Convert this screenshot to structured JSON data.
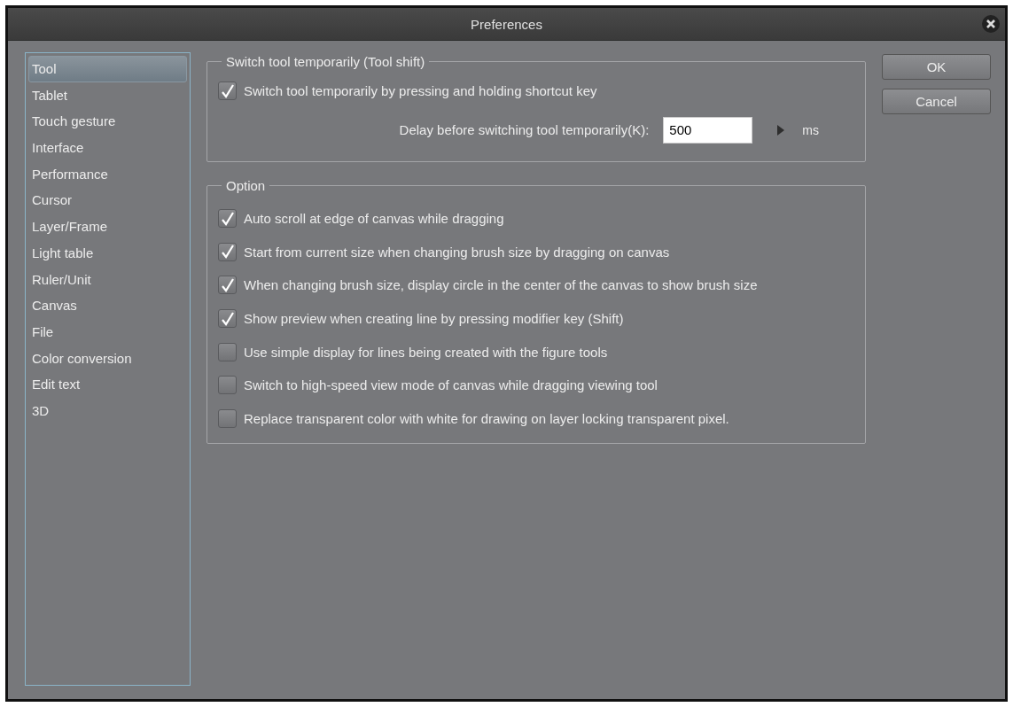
{
  "window": {
    "title": "Preferences"
  },
  "sidebar": {
    "items": [
      {
        "label": "Tool",
        "selected": true
      },
      {
        "label": "Tablet",
        "selected": false
      },
      {
        "label": "Touch gesture",
        "selected": false
      },
      {
        "label": "Interface",
        "selected": false
      },
      {
        "label": "Performance",
        "selected": false
      },
      {
        "label": "Cursor",
        "selected": false
      },
      {
        "label": "Layer/Frame",
        "selected": false
      },
      {
        "label": "Light table",
        "selected": false
      },
      {
        "label": "Ruler/Unit",
        "selected": false
      },
      {
        "label": "Canvas",
        "selected": false
      },
      {
        "label": "File",
        "selected": false
      },
      {
        "label": "Color conversion",
        "selected": false
      },
      {
        "label": "Edit text",
        "selected": false
      },
      {
        "label": "3D",
        "selected": false
      }
    ]
  },
  "tool_shift": {
    "title": "Switch tool temporarily (Tool shift)",
    "checkbox": {
      "label": "Switch tool temporarily by pressing and holding shortcut key",
      "checked": true
    },
    "delay": {
      "label": "Delay before switching tool temporarily(K):",
      "value": "500",
      "unit": "ms"
    }
  },
  "option": {
    "title": "Option",
    "items": [
      {
        "label": "Auto scroll at edge of canvas while dragging",
        "checked": true
      },
      {
        "label": "Start from current size when changing brush size by dragging on canvas",
        "checked": true
      },
      {
        "label": "When changing brush size, display circle in the center of the canvas to show brush size",
        "checked": true
      },
      {
        "label": "Show preview when creating line by pressing modifier key (Shift)",
        "checked": true
      },
      {
        "label": "Use simple display for lines being created with the figure tools",
        "checked": false
      },
      {
        "label": "Switch to high-speed view mode of canvas while dragging viewing tool",
        "checked": false
      },
      {
        "label": "Replace transparent color with white for drawing on layer locking transparent pixel.",
        "checked": false
      }
    ]
  },
  "buttons": [
    "OK",
    "Cancel"
  ]
}
